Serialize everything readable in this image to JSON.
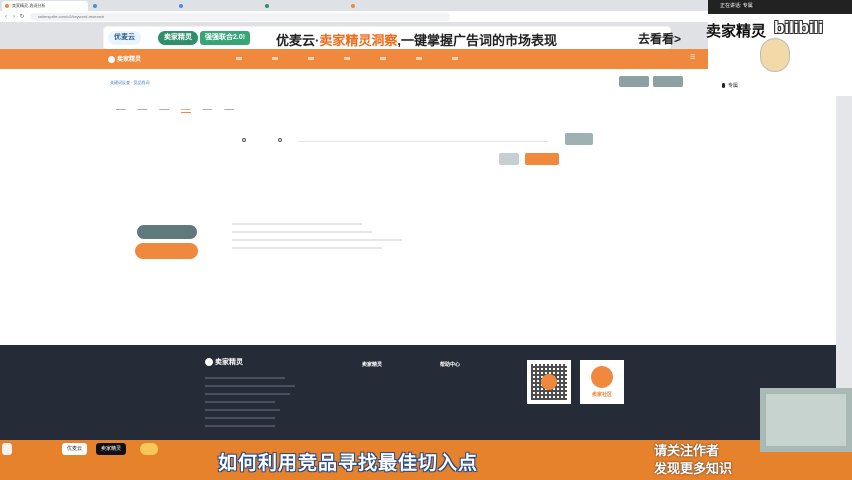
{
  "browser": {
    "tabs": [
      "卖家精灵-选词分析",
      "",
      "",
      "",
      ""
    ],
    "url": "sellersprite.com/v2/keyword-research"
  },
  "promo": {
    "logo1": "优麦云",
    "logo2": "卖家精灵",
    "tag": "强强联合2.0!",
    "text_prefix": "优麦云·",
    "text_highlight": "卖家精灵洞察",
    "text_suffix": ",一键掌握广告词的市场表现",
    "button": "去看看>"
  },
  "site": {
    "logo": "卖家精灵",
    "breadcrumb": "关键词反查 · 竞品找词"
  },
  "side_panel": {
    "speaking_label": "正在讲话:",
    "speaker": "专属",
    "brand": "卖家精灵",
    "platform": "bilibili",
    "user": "专属"
  },
  "footer": {
    "logo": "卖家精灵",
    "col1_title": "卖家精灵",
    "col2_title": "帮助中心",
    "community_label": "卖家社区"
  },
  "taskbar": {
    "items": [
      "优麦云",
      "卖家精灵",
      ""
    ]
  },
  "subtitle": {
    "main": "如何利用竞品寻找最佳切入点",
    "side_line1": "请关注作者",
    "side_line2": "发现更多知识"
  }
}
